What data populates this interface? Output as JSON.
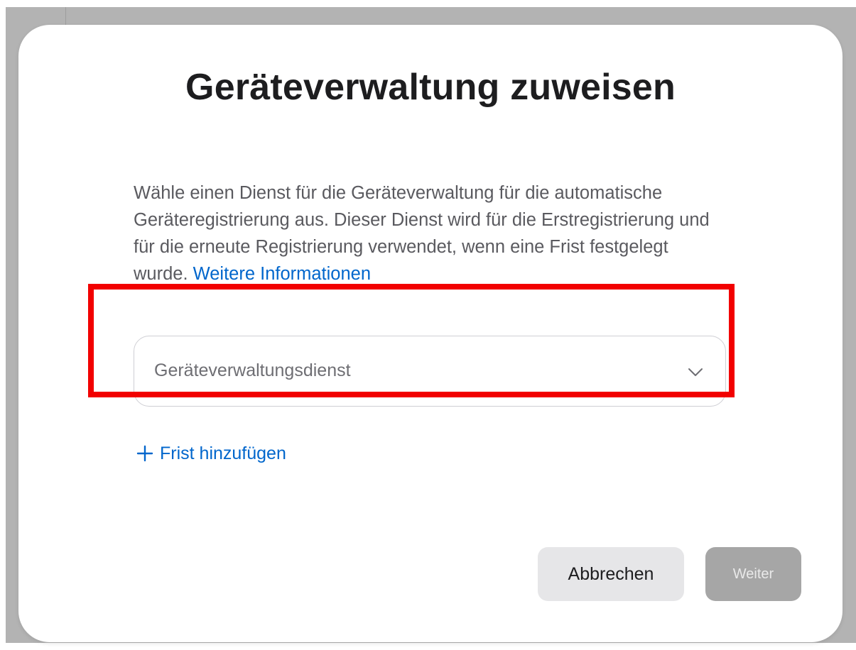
{
  "dialog": {
    "title": "Geräteverwaltung zuweisen",
    "description": "Wähle einen Dienst für die Geräteverwaltung für die automatische Geräteregistrierung aus. Dieser Dienst wird für die Erstregistrierung und für die erneute Registrierung verwendet, wenn eine Frist festgelegt wurde. ",
    "learn_more_link": "Weitere Informationen",
    "service_select": {
      "placeholder": "Geräteverwaltungsdienst",
      "icon": "chevron-down-icon"
    },
    "add_deadline": {
      "icon": "plus-icon",
      "label": "Frist hinzufügen"
    },
    "buttons": {
      "cancel_label": "Abbrechen",
      "next_label": "Weiter"
    }
  },
  "colors": {
    "accent_link": "#0066cc",
    "highlight_border": "#f20000",
    "backdrop": "#b3b3b3",
    "disabled_button": "#a6a6a6"
  }
}
